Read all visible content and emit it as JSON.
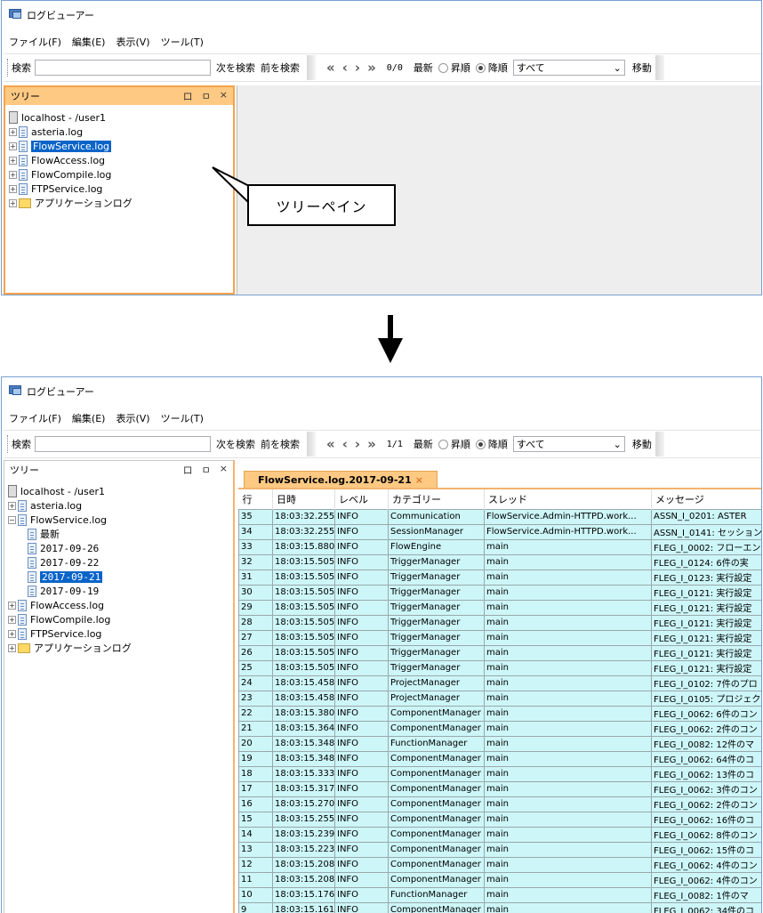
{
  "app_title": "ログビューアー",
  "menu": [
    "ファイル(F)",
    "編集(E)",
    "表示(V)",
    "ツール(T)"
  ],
  "toolbar": {
    "search_label": "検索",
    "search_value": "",
    "find_next": "次を検索",
    "find_prev": "前を検索",
    "latest": "最新",
    "asc": "昇順",
    "desc": "降順",
    "filter_value": "すべて",
    "move": "移動",
    "counter_before": "0/0",
    "counter_after": "1/1"
  },
  "tree_panel": {
    "title": "ツリー",
    "controls": [
      "ロ",
      "ㅁ",
      "×"
    ]
  },
  "tree_before": [
    {
      "label": "localhost - /user1",
      "type": "server"
    },
    {
      "label": "asteria.log",
      "type": "file"
    },
    {
      "label": "FlowService.log",
      "type": "file",
      "selected": true
    },
    {
      "label": "FlowAccess.log",
      "type": "file"
    },
    {
      "label": "FlowCompile.log",
      "type": "file"
    },
    {
      "label": "FTPService.log",
      "type": "file"
    },
    {
      "label": "アプリケーションログ",
      "type": "folder"
    }
  ],
  "tree_after": [
    {
      "label": "localhost - /user1",
      "type": "server",
      "indent": 0
    },
    {
      "label": "asteria.log",
      "type": "file",
      "indent": 0,
      "exp": "+"
    },
    {
      "label": "FlowService.log",
      "type": "file",
      "indent": 0,
      "exp": "−"
    },
    {
      "label": "最新",
      "type": "file",
      "indent": 1
    },
    {
      "label": "2017-09-26",
      "type": "file",
      "indent": 1,
      "mono": true
    },
    {
      "label": "2017-09-22",
      "type": "file",
      "indent": 1,
      "mono": true
    },
    {
      "label": "2017-09-21",
      "type": "file",
      "indent": 1,
      "mono": true,
      "selected": true
    },
    {
      "label": "2017-09-19",
      "type": "file",
      "indent": 1,
      "mono": true
    },
    {
      "label": "FlowAccess.log",
      "type": "file",
      "indent": 0,
      "exp": "+"
    },
    {
      "label": "FlowCompile.log",
      "type": "file",
      "indent": 0,
      "exp": "+"
    },
    {
      "label": "FTPService.log",
      "type": "file",
      "indent": 0,
      "exp": "+"
    },
    {
      "label": "アプリケーションログ",
      "type": "folder",
      "indent": 0,
      "exp": "+"
    }
  ],
  "callout": "ツリーペイン",
  "tab": {
    "label": "FlowService.log.2017-09-21",
    "close": "×"
  },
  "columns": [
    "行",
    "日時",
    "レベル",
    "カテゴリー",
    "スレッド",
    "メッセージ"
  ],
  "rows": [
    [
      "35",
      "18:03:32.255",
      "INFO",
      "Communication",
      "FlowService.Admin-HTTPD.work...",
      "ASSN_I_0201: ASTER"
    ],
    [
      "34",
      "18:03:32.255",
      "INFO",
      "SessionManager",
      "FlowService.Admin-HTTPD.work...",
      "ASSN_I_0141: セッション"
    ],
    [
      "33",
      "18:03:15.880",
      "INFO",
      "FlowEngine",
      "main",
      "FLEG_I_0002: フローエン"
    ],
    [
      "32",
      "18:03:15.505",
      "INFO",
      "TriggerManager",
      "main",
      "FLEG_I_0124: 6件の実"
    ],
    [
      "31",
      "18:03:15.505",
      "INFO",
      "TriggerManager",
      "main",
      "FLEG_I_0123: 実行設定"
    ],
    [
      "30",
      "18:03:15.505",
      "INFO",
      "TriggerManager",
      "main",
      "FLEG_I_0121: 実行設定"
    ],
    [
      "29",
      "18:03:15.505",
      "INFO",
      "TriggerManager",
      "main",
      "FLEG_I_0121: 実行設定"
    ],
    [
      "28",
      "18:03:15.505",
      "INFO",
      "TriggerManager",
      "main",
      "FLEG_I_0121: 実行設定"
    ],
    [
      "27",
      "18:03:15.505",
      "INFO",
      "TriggerManager",
      "main",
      "FLEG_I_0121: 実行設定"
    ],
    [
      "26",
      "18:03:15.505",
      "INFO",
      "TriggerManager",
      "main",
      "FLEG_I_0121: 実行設定"
    ],
    [
      "25",
      "18:03:15.505",
      "INFO",
      "TriggerManager",
      "main",
      "FLEG_I_0121: 実行設定"
    ],
    [
      "24",
      "18:03:15.458",
      "INFO",
      "ProjectManager",
      "main",
      "FLEG_I_0102: 7件のプロ"
    ],
    [
      "23",
      "18:03:15.458",
      "INFO",
      "ProjectManager",
      "main",
      "FLEG_I_0105: プロジェク"
    ],
    [
      "22",
      "18:03:15.380",
      "INFO",
      "ComponentManager",
      "main",
      "FLEG_I_0062: 6件のコン"
    ],
    [
      "21",
      "18:03:15.364",
      "INFO",
      "ComponentManager",
      "main",
      "FLEG_I_0062: 2件のコン"
    ],
    [
      "20",
      "18:03:15.348",
      "INFO",
      "FunctionManager",
      "main",
      "FLEG_I_0082: 12件のマ"
    ],
    [
      "19",
      "18:03:15.348",
      "INFO",
      "ComponentManager",
      "main",
      "FLEG_I_0062: 64件のコ"
    ],
    [
      "18",
      "18:03:15.333",
      "INFO",
      "ComponentManager",
      "main",
      "FLEG_I_0062: 13件のコ"
    ],
    [
      "17",
      "18:03:15.317",
      "INFO",
      "ComponentManager",
      "main",
      "FLEG_I_0062: 3件のコン"
    ],
    [
      "16",
      "18:03:15.270",
      "INFO",
      "ComponentManager",
      "main",
      "FLEG_I_0062: 2件のコン"
    ],
    [
      "15",
      "18:03:15.255",
      "INFO",
      "ComponentManager",
      "main",
      "FLEG_I_0062: 16件のコ"
    ],
    [
      "14",
      "18:03:15.239",
      "INFO",
      "ComponentManager",
      "main",
      "FLEG_I_0062: 8件のコン"
    ],
    [
      "13",
      "18:03:15.223",
      "INFO",
      "ComponentManager",
      "main",
      "FLEG_I_0062: 15件のコ"
    ],
    [
      "12",
      "18:03:15.208",
      "INFO",
      "ComponentManager",
      "main",
      "FLEG_I_0062: 4件のコン"
    ],
    [
      "11",
      "18:03:15.208",
      "INFO",
      "ComponentManager",
      "main",
      "FLEG_I_0062: 4件のコン"
    ],
    [
      "10",
      "18:03:15.176",
      "INFO",
      "FunctionManager",
      "main",
      "FLEG_I_0082: 1件のマ"
    ],
    [
      "9",
      "18:03:15.161",
      "INFO",
      "ComponentManager",
      "main",
      "FLEG_I_0062: 34件のコ"
    ]
  ],
  "colors": {
    "accent_orange": "#f4a44a",
    "tab_fill": "#fdc983",
    "row_fill": "#cdf6f8",
    "selection": "#0a64c8"
  }
}
